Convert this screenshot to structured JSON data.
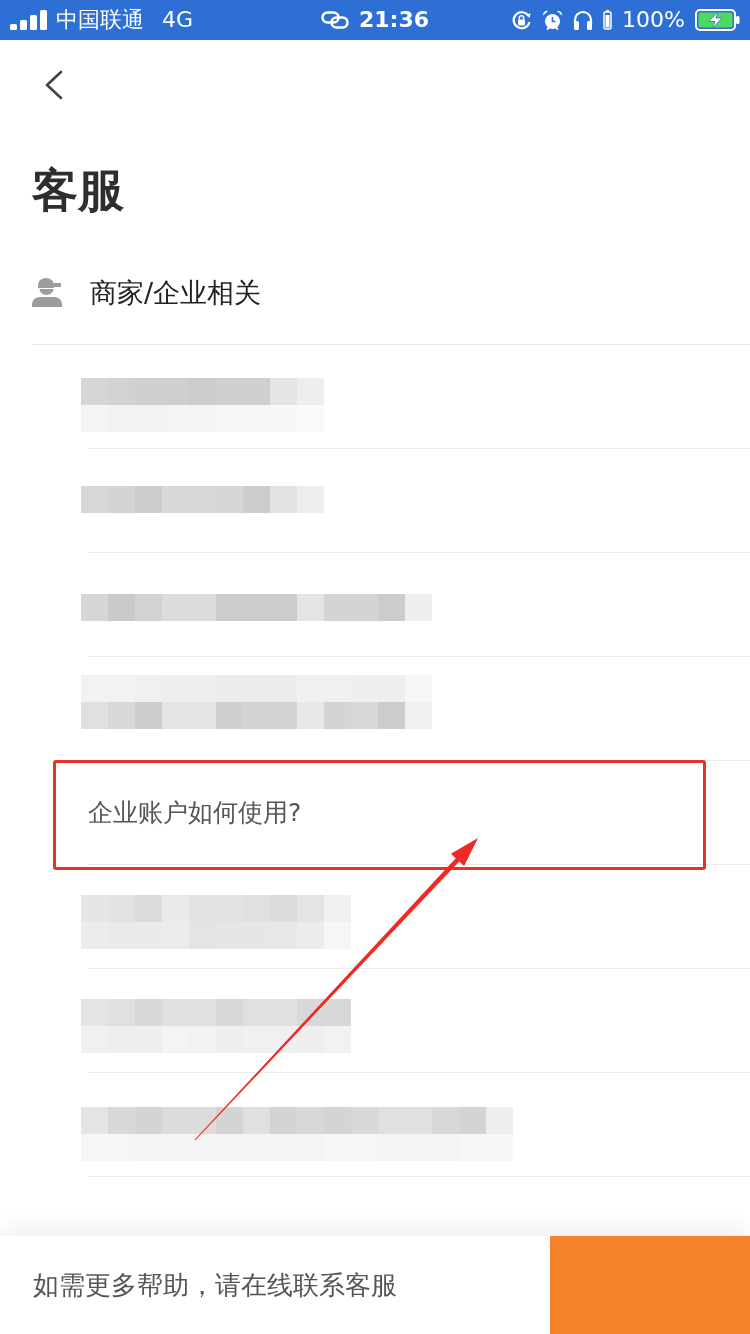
{
  "status_bar": {
    "carrier": "中国联通",
    "network": "4G",
    "time": "21:36",
    "battery": "100%"
  },
  "page": {
    "title": "客服"
  },
  "section": {
    "label": "商家/企业相关"
  },
  "questions": [
    {
      "kind": "pixelated",
      "highlighted": false
    },
    {
      "kind": "pixelated",
      "highlighted": false
    },
    {
      "kind": "pixelated",
      "highlighted": false
    },
    {
      "kind": "pixelated",
      "highlighted": false
    },
    {
      "kind": "question",
      "text": "企业账户如何使用?",
      "highlighted": true
    },
    {
      "kind": "pixelated",
      "highlighted": false
    },
    {
      "kind": "pixelated",
      "highlighted": false
    },
    {
      "kind": "pixelated",
      "highlighted": false
    }
  ],
  "footer": {
    "text": "如需更多帮助，请在线联系客服"
  }
}
